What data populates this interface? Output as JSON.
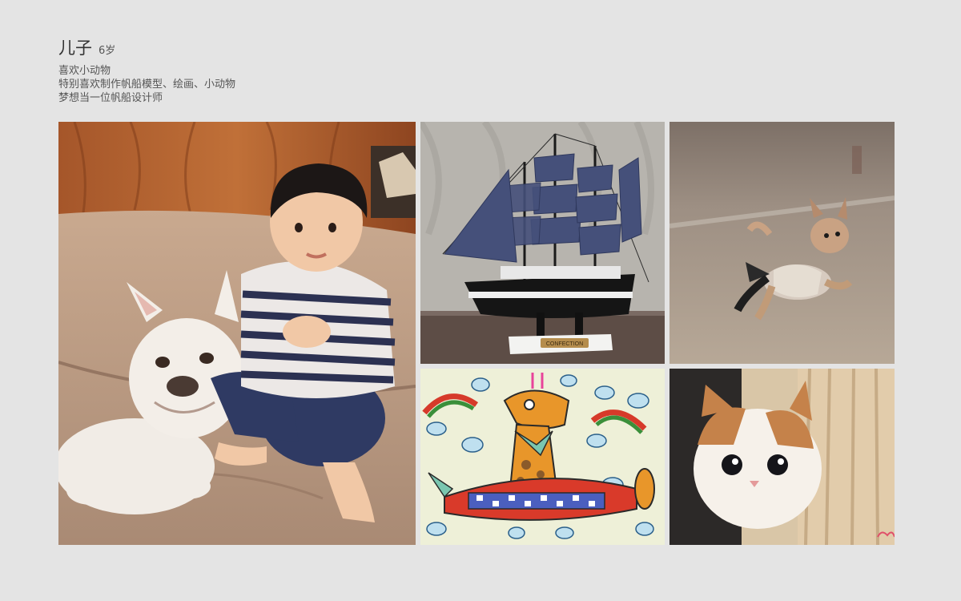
{
  "profile": {
    "title": "儿子",
    "age": "6岁",
    "lines": [
      "喜欢小动物",
      "特别喜欢制作帆船模型、绘画、小动物",
      "梦想当一位帆船设计师"
    ]
  },
  "photos": [
    {
      "subject": "boy-with-bulldog"
    },
    {
      "subject": "sailboat-model",
      "plaque_text": "CONFECTION"
    },
    {
      "subject": "running-puppy"
    },
    {
      "subject": "giraffe-airplane-drawing"
    },
    {
      "subject": "kitten"
    }
  ]
}
